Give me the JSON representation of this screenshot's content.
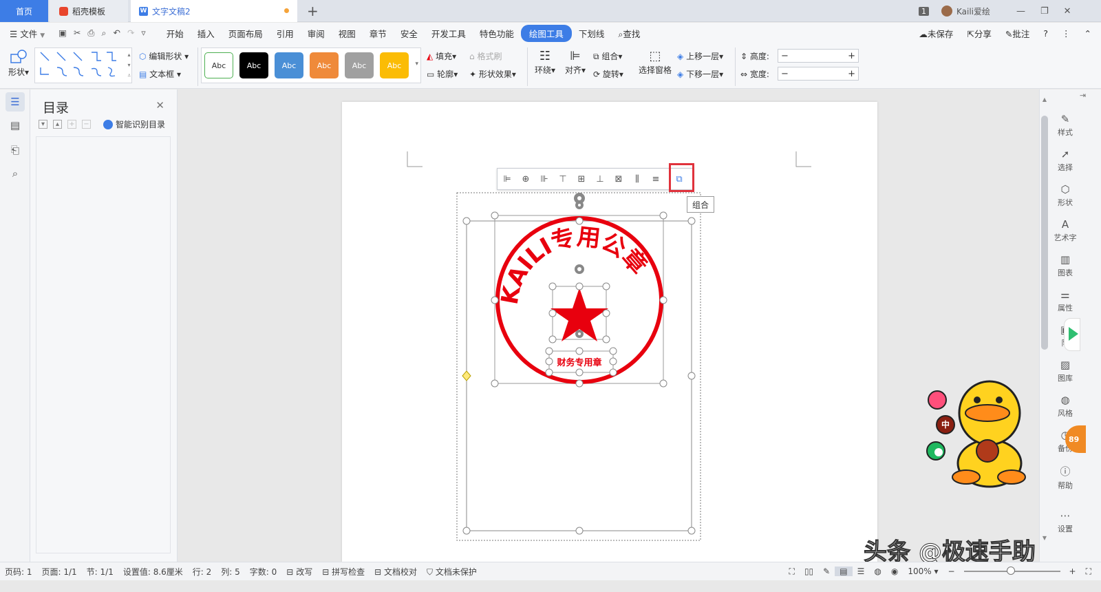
{
  "tabs": {
    "home": "首页",
    "template": "稻壳模板",
    "doc": "文字文稿2",
    "badge": "1",
    "user": "Kaili爱绘"
  },
  "menu": {
    "file": "文件",
    "items": [
      "开始",
      "插入",
      "页面布局",
      "引用",
      "审阅",
      "视图",
      "章节",
      "安全",
      "开发工具",
      "特色功能"
    ],
    "active": "绘图工具",
    "after": [
      "下划线"
    ],
    "search": "查找",
    "right": [
      "未保存",
      "分享",
      "批注"
    ]
  },
  "ribbon": {
    "shape": "形状",
    "edit_shape": "编辑形状",
    "textbox": "文本框",
    "style_label": "Abc",
    "fill": "填充",
    "format_brush": "格式刷",
    "outline": "轮廓",
    "shape_effect": "形状效果",
    "wrap": "环绕",
    "align": "对齐",
    "group": "组合",
    "rotate": "旋转",
    "select_pane": "选择窗格",
    "bring_forward": "上移一层",
    "send_backward": "下移一层",
    "height": "高度:",
    "width": "宽度:"
  },
  "colors": {
    "accent": "#3d7de6",
    "stamp_red": "#e8000e",
    "highlight_red": "#e0323c"
  },
  "toc": {
    "title": "目录",
    "smart": "智能识别目录"
  },
  "stamp": {
    "arc_text": "KAILI专用公章",
    "bottom_text": "财务专用章"
  },
  "tooltip": "组合",
  "right_panel": [
    "样式",
    "选择",
    "形状",
    "艺术字",
    "图表",
    "属性",
    "限",
    "图库",
    "风格",
    "备份",
    "帮助",
    "设置"
  ],
  "floating_badges": {
    "mid": "中",
    "orange": "89"
  },
  "status": {
    "page_no": "页码: 1",
    "pages": "页面: 1/1",
    "section": "节: 1/1",
    "setting": "设置值: 8.6厘米",
    "row": "行: 2",
    "col": "列: 5",
    "chars": "字数: 0",
    "revise": "改写",
    "spell": "拼写检查",
    "proof": "文档校对",
    "protect": "文档未保护",
    "zoom": "100%"
  },
  "watermark": "头条 @极速手助"
}
